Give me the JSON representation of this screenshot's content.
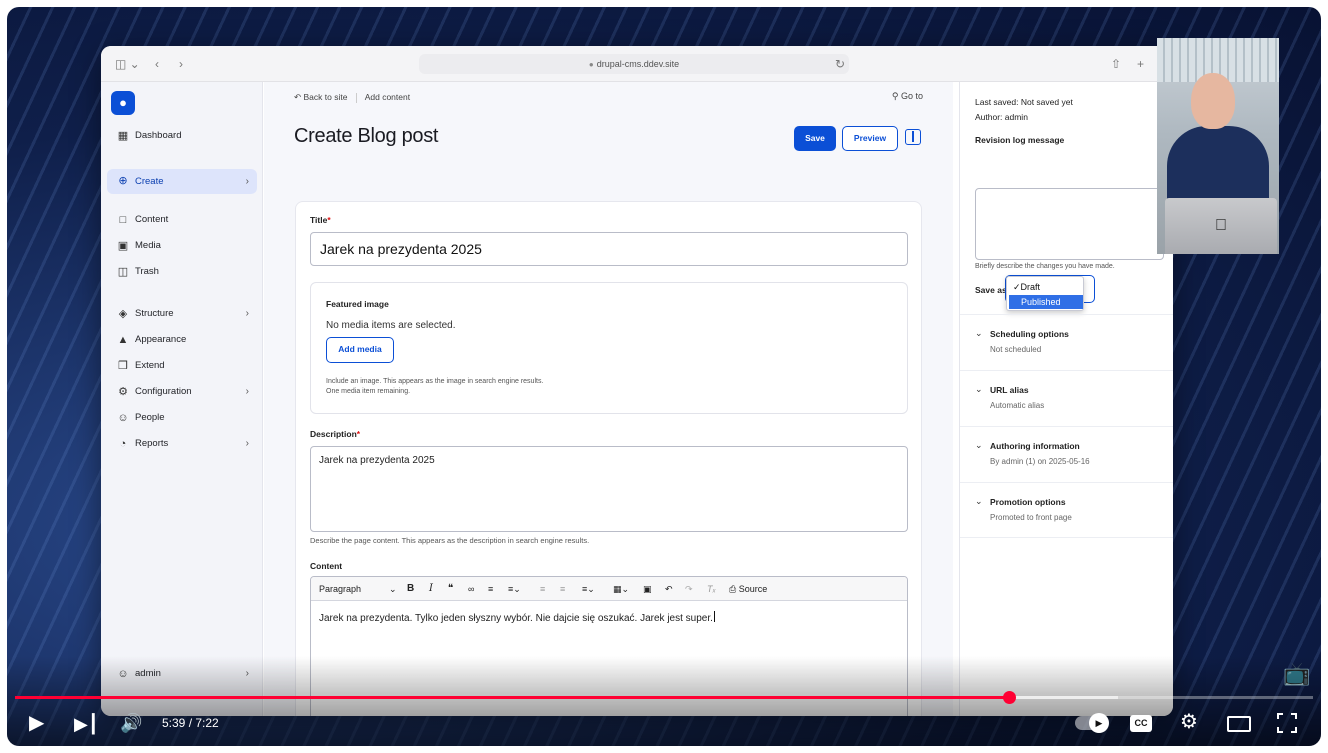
{
  "browser": {
    "url": "drupal-cms.ddev.site"
  },
  "sidebar": {
    "items": [
      {
        "label": "Dashboard",
        "icon": "dashboard-icon"
      },
      {
        "label": "Create",
        "icon": "plus-circle-icon"
      },
      {
        "label": "Content",
        "icon": "document-icon"
      },
      {
        "label": "Media",
        "icon": "image-icon"
      },
      {
        "label": "Trash",
        "icon": "trash-icon"
      },
      {
        "label": "Structure",
        "icon": "layers-icon"
      },
      {
        "label": "Appearance",
        "icon": "paint-icon"
      },
      {
        "label": "Extend",
        "icon": "puzzle-icon"
      },
      {
        "label": "Configuration",
        "icon": "gear-icon"
      },
      {
        "label": "People",
        "icon": "people-icon"
      },
      {
        "label": "Reports",
        "icon": "chart-icon"
      }
    ],
    "user": "admin"
  },
  "main": {
    "breadcrumb_back": "Back to site",
    "breadcrumb_current": "Add content",
    "goto": "Go to",
    "title": "Create Blog post",
    "save": "Save",
    "preview": "Preview",
    "form": {
      "title_label": "Title",
      "title_value": "Jarek na prezydenta 2025",
      "featured_label": "Featured image",
      "no_media": "No media items are selected.",
      "add_media": "Add media",
      "media_help_1": "Include an image. This appears as the image in search engine results.",
      "media_help_2": "One media item remaining.",
      "description_label": "Description",
      "description_value": "Jarek na prezydenta 2025",
      "description_help": "Describe the page content. This appears as the description in search engine results.",
      "content_label": "Content",
      "paragraph": "Paragraph",
      "source": "Source",
      "content_value": "Jarek na prezydenta. Tylko jeden słyszny wybór. Nie dajcie się oszukać. Jarek jest super."
    }
  },
  "side": {
    "last_saved": "Last saved: Not saved yet",
    "author": "Author: admin",
    "revision_label": "Revision log message",
    "revision_help": "Briefly describe the changes you have made.",
    "save_as": "Save as",
    "options": [
      "Draft",
      "Published"
    ],
    "selected_option": "Published",
    "sections": [
      {
        "title": "Scheduling options",
        "value": "Not scheduled"
      },
      {
        "title": "URL alias",
        "value": "Automatic alias"
      },
      {
        "title": "Authoring information",
        "value": "By admin (1) on 2025-05-16"
      },
      {
        "title": "Promotion options",
        "value": "Promoted to front page"
      }
    ]
  },
  "player": {
    "time": "5:39 / 7:22",
    "played_fraction": 0.766,
    "buffered_fraction": 0.85,
    "accent": "#ff0033"
  }
}
